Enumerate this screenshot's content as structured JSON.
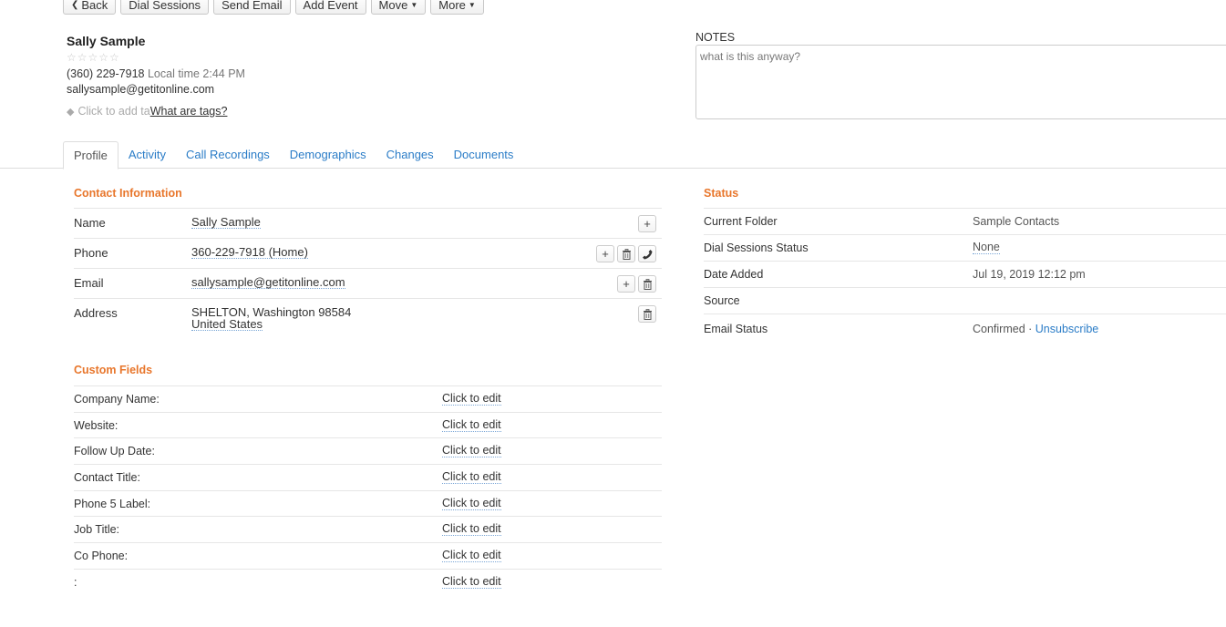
{
  "toolbar": {
    "back": "Back",
    "dial_sessions": "Dial Sessions",
    "send_email": "Send Email",
    "add_event": "Add Event",
    "move": "Move",
    "more": "More"
  },
  "contact": {
    "name": "Sally Sample",
    "stars": "☆☆☆☆☆",
    "phone": "(360) 229-7918",
    "local_time": "Local time 2:44 PM",
    "email": "sallysample@getitonline.com",
    "tag_placeholder": "Click to add ta",
    "tag_help": "What are tags?"
  },
  "notes": {
    "label": "NOTES",
    "value": "what is this anyway?"
  },
  "tabs": [
    "Profile",
    "Activity",
    "Call Recordings",
    "Demographics",
    "Changes",
    "Documents"
  ],
  "contact_info": {
    "title": "Contact Information",
    "name_label": "Name",
    "name_value": "Sally Sample",
    "phone_label": "Phone",
    "phone_value": "360-229-7918 (Home)",
    "email_label": "Email",
    "email_value": "sallysample@getitonline.com",
    "address_label": "Address",
    "address_line1": "SHELTON, Washington 98584",
    "address_line2": "United States"
  },
  "custom_fields": {
    "title": "Custom Fields",
    "edit_text": "Click to edit",
    "labels": [
      "Company Name:",
      "Website:",
      "Follow Up Date:",
      "Contact Title:",
      "Phone 5 Label:",
      "Job Title:",
      "Co Phone:",
      ":"
    ]
  },
  "status": {
    "title": "Status",
    "current_folder_label": "Current Folder",
    "current_folder_value": "Sample Contacts",
    "dial_status_label": "Dial Sessions Status",
    "dial_status_value": "None",
    "date_added_label": "Date Added",
    "date_added_value": "Jul 19, 2019 12:12 pm",
    "source_label": "Source",
    "email_status_label": "Email Status",
    "email_status_value": "Confirmed · ",
    "unsubscribe": "Unsubscribe"
  }
}
